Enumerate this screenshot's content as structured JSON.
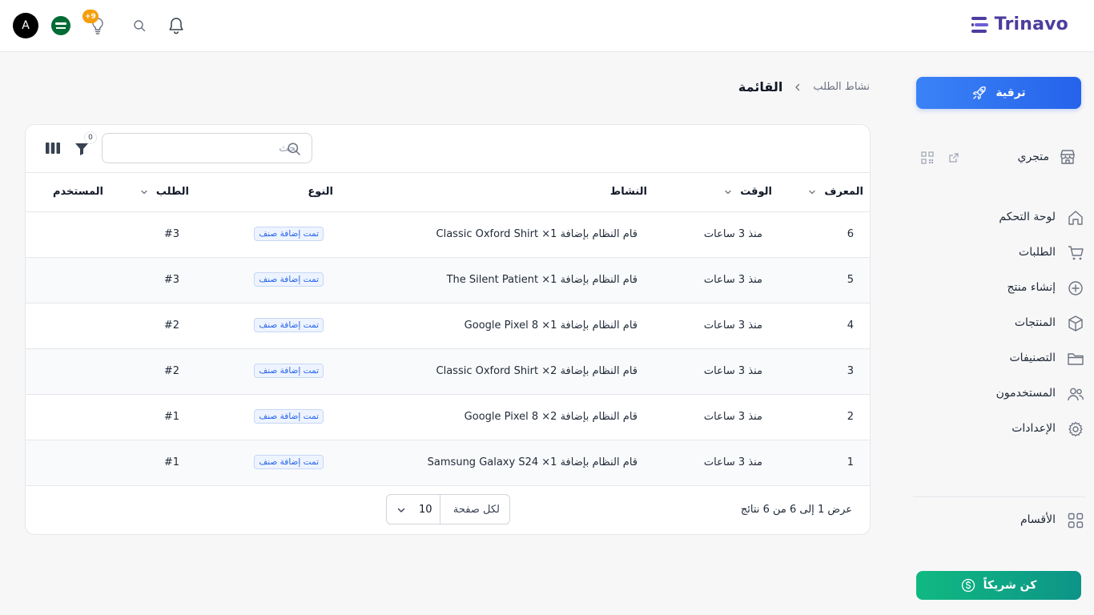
{
  "app": {
    "name": "Trinavo",
    "brand_color": "#4c3d9e",
    "accent_color": "#2563eb",
    "success_color": "#0d9488"
  },
  "header": {
    "avatar_initial": "A",
    "tips_badge": "+9",
    "icons": [
      "bell-icon",
      "search-icon",
      "lightbulb-icon",
      "flag-icon"
    ]
  },
  "sidebar": {
    "upgrade_label": "ترقية",
    "store_label": "متجري",
    "items": [
      {
        "label": "لوحة التحكم",
        "icon": "home-icon"
      },
      {
        "label": "الطلبات",
        "icon": "cart-icon"
      },
      {
        "label": "إنشاء منتج",
        "icon": "plus-circle-icon"
      },
      {
        "label": "المنتجات",
        "icon": "box-icon"
      },
      {
        "label": "التصنيفات",
        "icon": "folder-icon"
      },
      {
        "label": "المستخدمون",
        "icon": "users-icon"
      },
      {
        "label": "الإعدادات",
        "icon": "gear-icon"
      }
    ],
    "sections_label": "الأقسام",
    "partner_label": "كن شريكاً"
  },
  "breadcrumb": {
    "parent": "نشاط الطلب",
    "current": "القائمة"
  },
  "table": {
    "search_placeholder": "بحث",
    "filter_count": "0",
    "columns": {
      "id": "المعرف",
      "time": "الوقت",
      "activity": "النشاط",
      "type": "النوع",
      "order": "الطلب",
      "user": "المستخدم"
    },
    "rows": [
      {
        "id": "6",
        "time": "منذ 3 ساعات",
        "activity": "قام النظام بإضافة 1× Classic Oxford Shirt",
        "type": "تمت إضافة صنف",
        "order": "#3",
        "user": ""
      },
      {
        "id": "5",
        "time": "منذ 3 ساعات",
        "activity": "قام النظام بإضافة 1× The Silent Patient",
        "type": "تمت إضافة صنف",
        "order": "#3",
        "user": ""
      },
      {
        "id": "4",
        "time": "منذ 3 ساعات",
        "activity": "قام النظام بإضافة 1× Google Pixel 8",
        "type": "تمت إضافة صنف",
        "order": "#2",
        "user": ""
      },
      {
        "id": "3",
        "time": "منذ 3 ساعات",
        "activity": "قام النظام بإضافة 2× Classic Oxford Shirt",
        "type": "تمت إضافة صنف",
        "order": "#2",
        "user": ""
      },
      {
        "id": "2",
        "time": "منذ 3 ساعات",
        "activity": "قام النظام بإضافة 2× Google Pixel 8",
        "type": "تمت إضافة صنف",
        "order": "#1",
        "user": ""
      },
      {
        "id": "1",
        "time": "منذ 3 ساعات",
        "activity": "قام النظام بإضافة 1× Samsung Galaxy S24",
        "type": "تمت إضافة صنف",
        "order": "#1",
        "user": ""
      }
    ],
    "results_text": "عرض 1 إلى 6 من 6 نتائج",
    "per_page_label": "لكل صفحة",
    "per_page_value": "10"
  }
}
